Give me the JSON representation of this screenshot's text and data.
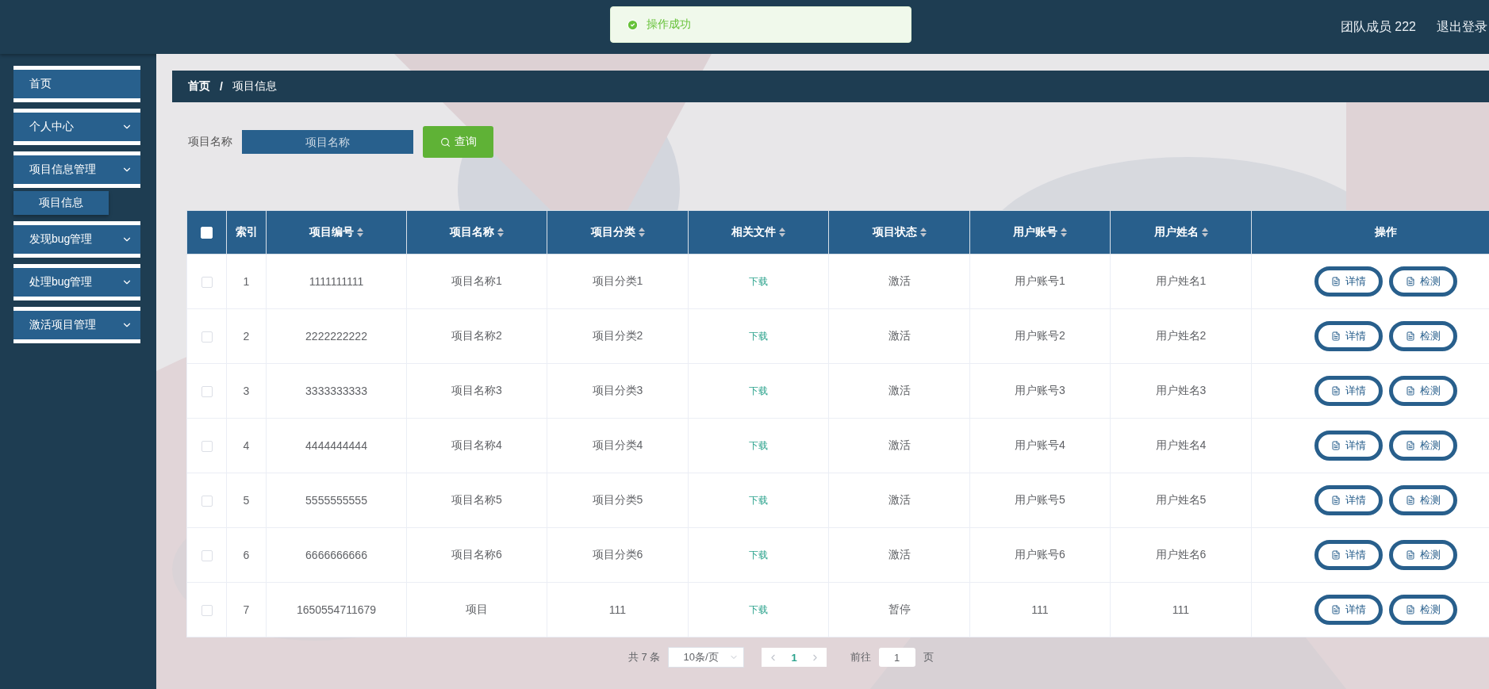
{
  "header": {
    "toast": "操作成功",
    "user": "团队成员 222",
    "logout": "退出登录"
  },
  "sidebar": {
    "items": [
      {
        "kind": "link",
        "label": "首页"
      },
      {
        "kind": "group",
        "label": "个人中心"
      },
      {
        "kind": "group",
        "label": "项目信息管理",
        "children": [
          {
            "label": "项目信息"
          }
        ]
      },
      {
        "kind": "group",
        "label": "发现bug管理"
      },
      {
        "kind": "group",
        "label": "处理bug管理"
      },
      {
        "kind": "group",
        "label": "激活项目管理"
      }
    ]
  },
  "breadcrumb": {
    "items": [
      "首页",
      "项目信息"
    ],
    "separator": "/"
  },
  "search": {
    "label": "项目名称",
    "placeholder": "项目名称",
    "button": "查询"
  },
  "table": {
    "select_all": {
      "checked": false
    },
    "columns": [
      {
        "label": "索引",
        "sortable": false
      },
      {
        "label": "项目编号",
        "sortable": true
      },
      {
        "label": "项目名称",
        "sortable": true
      },
      {
        "label": "项目分类",
        "sortable": true
      },
      {
        "label": "相关文件",
        "sortable": true
      },
      {
        "label": "项目状态",
        "sortable": true
      },
      {
        "label": "用户账号",
        "sortable": true
      },
      {
        "label": "用户姓名",
        "sortable": true
      },
      {
        "label": "操作",
        "sortable": false
      }
    ],
    "rows": [
      {
        "checked": false,
        "cells": [
          "1",
          "1111111111",
          "项目名称1",
          "项目分类1",
          "下载",
          "激活",
          "用户账号1",
          "用户姓名1"
        ],
        "actions": [
          "详情",
          "检测"
        ]
      },
      {
        "checked": false,
        "cells": [
          "2",
          "2222222222",
          "项目名称2",
          "项目分类2",
          "下载",
          "激活",
          "用户账号2",
          "用户姓名2"
        ],
        "actions": [
          "详情",
          "检测"
        ]
      },
      {
        "checked": false,
        "cells": [
          "3",
          "3333333333",
          "项目名称3",
          "项目分类3",
          "下载",
          "激活",
          "用户账号3",
          "用户姓名3"
        ],
        "actions": [
          "详情",
          "检测"
        ]
      },
      {
        "checked": false,
        "cells": [
          "4",
          "4444444444",
          "项目名称4",
          "项目分类4",
          "下载",
          "激活",
          "用户账号4",
          "用户姓名4"
        ],
        "actions": [
          "详情",
          "检测"
        ]
      },
      {
        "checked": false,
        "cells": [
          "5",
          "5555555555",
          "项目名称5",
          "项目分类5",
          "下载",
          "激活",
          "用户账号5",
          "用户姓名5"
        ],
        "actions": [
          "详情",
          "检测"
        ]
      },
      {
        "checked": false,
        "cells": [
          "6",
          "6666666666",
          "项目名称6",
          "项目分类6",
          "下载",
          "激活",
          "用户账号6",
          "用户姓名6"
        ],
        "actions": [
          "详情",
          "检测"
        ]
      },
      {
        "checked": false,
        "cells": [
          "7",
          "1650554711679",
          "项目",
          "111",
          "下载",
          "暂停",
          "111",
          "111"
        ],
        "actions": [
          "详情",
          "检测"
        ]
      }
    ]
  },
  "pagination": {
    "total": "共 7 条",
    "page_size": "10条/页",
    "pages": [
      {
        "label": "1",
        "selected": true
      }
    ],
    "goto_label": "前往",
    "goto_value": "1",
    "goto_suffix": "页"
  }
}
